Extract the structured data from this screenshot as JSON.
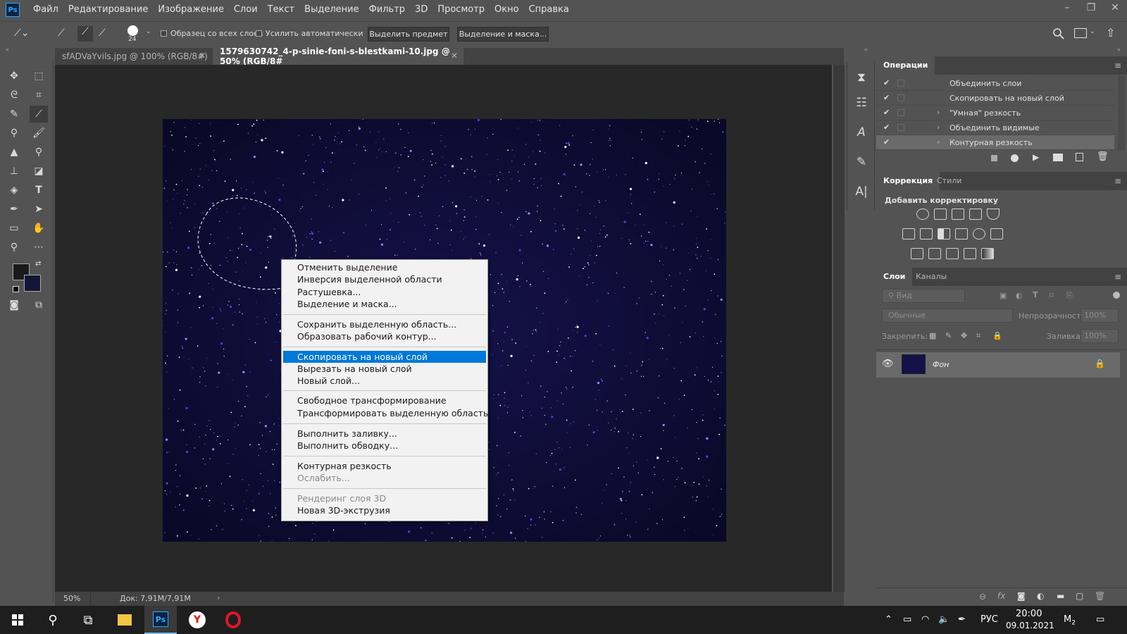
{
  "app": {
    "logo": "Ps"
  },
  "menu": [
    "Файл",
    "Редактирование",
    "Изображение",
    "Слои",
    "Текст",
    "Выделение",
    "Фильтр",
    "3D",
    "Просмотр",
    "Окно",
    "Справка"
  ],
  "options": {
    "brush_size": "24",
    "sample_all_layers": "Образец со всех слоев",
    "auto_enhance": "Усилить автоматически",
    "select_subject": "Выделить предмет",
    "select_and_mask": "Выделение и маска..."
  },
  "tabs": [
    {
      "label": "sfADVaYvils.jpg @ 100% (RGB/8#)"
    },
    {
      "label": "1579630742_4-p-sinie-foni-s-blestkami-10.jpg @ 50% (RGB/8#"
    }
  ],
  "status": {
    "zoom": "50%",
    "doc": "Док: 7,91M/7,91M"
  },
  "context_menu": {
    "items": [
      {
        "label": "Отменить выделение"
      },
      {
        "label": "Инверсия выделенной области"
      },
      {
        "label": "Растушевка..."
      },
      {
        "label": "Выделение и маска..."
      },
      {
        "label": "Сохранить выделенную область..."
      },
      {
        "label": "Образовать рабочий контур..."
      },
      {
        "label": "Скопировать на новый слой",
        "highlighted": true
      },
      {
        "label": "Вырезать на новый слой"
      },
      {
        "label": "Новый слой..."
      },
      {
        "label": "Свободное трансформирование"
      },
      {
        "label": "Трансформировать выделенную область"
      },
      {
        "label": "Выполнить заливку..."
      },
      {
        "label": "Выполнить обводку..."
      },
      {
        "label": "Контурная резкость"
      },
      {
        "label": "Ослабить...",
        "disabled": true
      },
      {
        "label": "Рендеринг слоя 3D",
        "disabled": true
      },
      {
        "label": "Новая 3D-экструзия"
      }
    ]
  },
  "operations": {
    "tab": "Операции",
    "rows": [
      {
        "label": "Объединить слои"
      },
      {
        "label": "Скопировать на новый слой"
      },
      {
        "label": "\"Умная\" резкость"
      },
      {
        "label": "Объединить видимые"
      },
      {
        "label": "Контурная резкость"
      }
    ]
  },
  "adjust": {
    "tab1": "Коррекция",
    "tab2": "Стили",
    "add_label": "Добавить корректировку"
  },
  "layers": {
    "tab1": "Слои",
    "tab2": "Каналы",
    "search_placeholder": "Вид",
    "blend_mode": "Обычные",
    "opacity_label": "Непрозрачность:",
    "opacity_value": "100%",
    "lock_label": "Закрепить:",
    "fill_label": "Заливка:",
    "fill_value": "100%",
    "layer_name": "Фон"
  },
  "taskbar": {
    "lang": "РУС",
    "time": "20:00",
    "date": "09.01.2021",
    "badge": "2"
  },
  "colors": {
    "accent": "#0078d7",
    "canvas_bg": "#0d0b2e",
    "ps_blue": "#31a8ff"
  }
}
